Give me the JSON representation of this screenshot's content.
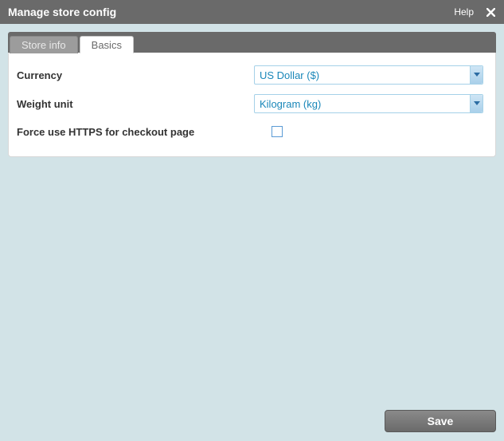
{
  "titlebar": {
    "title": "Manage store config",
    "help_label": "Help"
  },
  "tabs": [
    {
      "label": "Store info",
      "active": false
    },
    {
      "label": "Basics",
      "active": true
    }
  ],
  "form": {
    "currency": {
      "label": "Currency",
      "value": "US Dollar ($)"
    },
    "weight_unit": {
      "label": "Weight unit",
      "value": "Kilogram (kg)"
    },
    "force_https": {
      "label": "Force use HTTPS for checkout page",
      "checked": false
    }
  },
  "footer": {
    "save_label": "Save"
  }
}
